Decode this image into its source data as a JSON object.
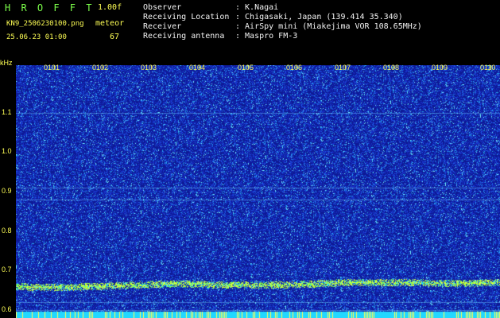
{
  "header": {
    "app_name": "H R O F F T",
    "version": "1.00f",
    "filename": "KN9_2506230100.png",
    "datetime": "25.06.23 01:00",
    "meteor_label": "meteor",
    "meteor_count": "67"
  },
  "info": {
    "observer_label": "Observer",
    "observer_value": ": K.Nagai",
    "location_label": "Receiving Location",
    "location_value": ": Chigasaki, Japan (139.414 35.340)",
    "receiver_label": "Receiver",
    "receiver_value": ": AirSpy mini (Miakejima VOR 108.65MHz)",
    "antenna_label": "Receiving antenna",
    "antenna_value": ": Maspro FM-3"
  },
  "colors": {
    "background": "#000000",
    "header_green": "#7cff4a",
    "axis_yellow": "#ffff55",
    "spectrogram_blue": "#1428b8",
    "echo_cyan": "#22d8ff",
    "band_yellow": "#d8ff3a"
  },
  "chart_data": {
    "type": "heatmap",
    "xlabel": "",
    "ylabel": "kHz",
    "minute_ticks": [
      "0101",
      "0102",
      "0103",
      "0104",
      "0105",
      "0106",
      "0107",
      "0108",
      "0109",
      "0110"
    ],
    "khz_ticks": [
      "1.1",
      "1.0",
      "0.9",
      "0.8",
      "0.7",
      "0.6"
    ],
    "khz_values": [
      1.1,
      1.0,
      0.9,
      0.8,
      0.7,
      0.6
    ],
    "ylim": [
      0.58,
      1.22
    ],
    "carrier_khz": 0.66,
    "horizontal_lines_khz": [
      1.1,
      0.91,
      0.88,
      0.62,
      0.6
    ]
  }
}
